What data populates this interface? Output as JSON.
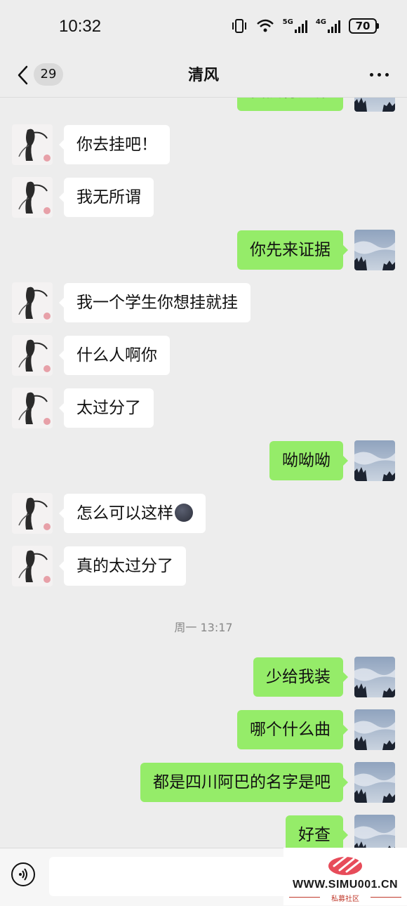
{
  "status_bar": {
    "time": "10:32",
    "network_5g": "5G",
    "network_4g": "4G",
    "battery": "70"
  },
  "nav": {
    "unread_count": "29",
    "title": "清风"
  },
  "messages": [
    {
      "side": "right",
      "text": "我执行挂你"
    },
    {
      "side": "left",
      "text": "你去挂吧！"
    },
    {
      "side": "left",
      "text": "我无所谓"
    },
    {
      "side": "right",
      "text": "你先来证据"
    },
    {
      "side": "left",
      "text": "我一个学生你想挂就挂"
    },
    {
      "side": "left",
      "text": "什么人啊你"
    },
    {
      "side": "left",
      "text": "太过分了"
    },
    {
      "side": "right",
      "text": "呦呦呦"
    },
    {
      "side": "left",
      "text": "怎么可以这样",
      "emoji": "dark-moon-face"
    },
    {
      "side": "left",
      "text": "真的太过分了"
    },
    {
      "side": "right",
      "text": "少给我装"
    },
    {
      "side": "right",
      "text": "哪个什么曲"
    },
    {
      "side": "right",
      "text": "都是四川阿巴的名字是吧"
    },
    {
      "side": "right",
      "text": "好查"
    }
  ],
  "timestamp": "周一 13:17",
  "watermark": {
    "site": "WWW.SIMU001.CN",
    "subtitle": "私募社区"
  },
  "colors": {
    "background": "#ededed",
    "outgoing_bubble": "#95ec69",
    "incoming_bubble": "#ffffff"
  }
}
